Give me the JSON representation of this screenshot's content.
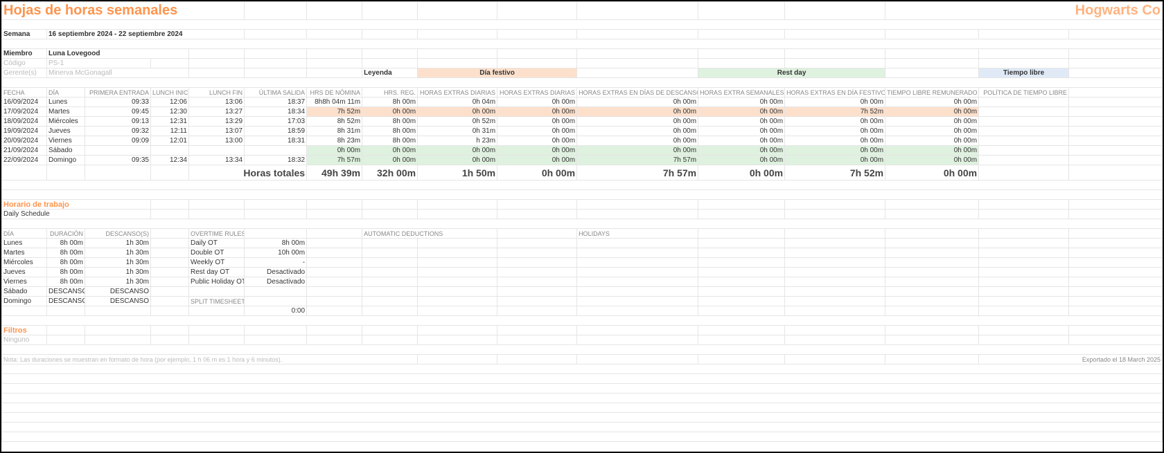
{
  "title": "Hojas de horas semanales",
  "company": "Hogwarts Co",
  "meta": {
    "week_label": "Semana",
    "week_value": "16 septiembre 2024 - 22 septiembre 2024",
    "member_label": "Miembro",
    "member_value": "Luna Lovegood",
    "code_label": "Código",
    "code_value": "PS-1",
    "managers_label": "Gerente(s)",
    "managers_value": "Minerva McGonagall"
  },
  "legend": {
    "label": "Leyenda",
    "holiday": "Día festivo",
    "rest": "Rest day",
    "timeoff": "Tiempo libre"
  },
  "columns": {
    "fecha": "FECHA",
    "dia": "DÍA",
    "primera": "PRIMERA ENTRADA",
    "lunch_in": "Lunch Inicio",
    "lunch_fin": "Lunch Fin",
    "ultima": "ÚLTIMA SALIDA",
    "nomina": "HRS DE NÓMINA",
    "reg": "HRS. REG.",
    "ot_diaria1": "HORAS EXTRAS DIARIAS",
    "ot_diaria2": "HORAS EXTRAS DIARIAS",
    "ot_descanso": "HORAS EXTRAS EN DÍAS DE DESCANSO",
    "ot_semanales": "HORAS EXTRA SEMANALES",
    "ot_festivo": "HORAS EXTRAS EN DÍA FESTIVO",
    "tiempo_rem": "TIEMPO LIBRE REMUNERADO",
    "politica": "POLÍTICA DE TIEMPO LIBRE"
  },
  "rows": [
    {
      "fecha": "16/09/2024",
      "dia": "Lunes",
      "in": "09:33",
      "li": "12:06",
      "lf": "13:06",
      "out": "18:37",
      "nom": "8h8h 04m 11m",
      "reg": "8h 00m",
      "d1": "0h 04m",
      "d2": "0h 00m",
      "desc": "0h 00m",
      "sem": "0h 00m",
      "fest": "0h 00m",
      "rem": "0h 00m",
      "cls": ""
    },
    {
      "fecha": "17/09/2024",
      "dia": "Martes",
      "in": "09:45",
      "li": "12:30",
      "lf": "13:27",
      "out": "18:34",
      "nom": "7h 52m",
      "reg": "0h 00m",
      "d1": "0h 00m",
      "d2": "0h 00m",
      "desc": "0h 00m",
      "sem": "0h 00m",
      "fest": "7h 52m",
      "rem": "0h 00m",
      "cls": "orange-fill"
    },
    {
      "fecha": "18/09/2024",
      "dia": "Miércoles",
      "in": "09:13",
      "li": "12:31",
      "lf": "13:29",
      "out": "17:03",
      "nom": "8h 52m",
      "reg": "8h 00m",
      "d1": "0h 52m",
      "d2": "0h 00m",
      "desc": "0h 00m",
      "sem": "0h 00m",
      "fest": "0h 00m",
      "rem": "0h 00m",
      "cls": ""
    },
    {
      "fecha": "19/09/2024",
      "dia": "Jueves",
      "in": "09:32",
      "li": "12:11",
      "lf": "13:07",
      "out": "18:59",
      "nom": "8h 31m",
      "reg": "8h 00m",
      "d1": "0h 31m",
      "d2": "0h 00m",
      "desc": "0h 00m",
      "sem": "0h 00m",
      "fest": "0h 00m",
      "rem": "0h 00m",
      "cls": ""
    },
    {
      "fecha": "20/09/2024",
      "dia": "Viernes",
      "in": "09:09",
      "li": "12:01",
      "lf": "13:00",
      "out": "18:31",
      "nom": "8h 23m",
      "reg": "8h 00m",
      "d1": "h 23m",
      "d2": "0h 00m",
      "desc": "0h 00m",
      "sem": "0h 00m",
      "fest": "0h 00m",
      "rem": "0h 00m",
      "cls": ""
    },
    {
      "fecha": "21/09/2024",
      "dia": "Sábado",
      "in": "",
      "li": "",
      "lf": "",
      "out": "",
      "nom": "0h 00m",
      "reg": "0h 00m",
      "d1": "0h 00m",
      "d2": "0h 00m",
      "desc": "0h 00m",
      "sem": "0h 00m",
      "fest": "0h 00m",
      "rem": "0h 00m",
      "cls": "green-fill"
    },
    {
      "fecha": "22/09/2024",
      "dia": "Domingo",
      "in": "09:35",
      "li": "12:34",
      "lf": "13:34",
      "out": "18:32",
      "nom": "7h 57m",
      "reg": "0h 00m",
      "d1": "0h 00m",
      "d2": "0h 00m",
      "desc": "7h 57m",
      "sem": "0h 00m",
      "fest": "0h 00m",
      "rem": "0h 00m",
      "cls": "green-fill"
    }
  ],
  "totals": {
    "label": "Horas totales",
    "nom": "49h 39m",
    "reg": "32h 00m",
    "d1": "1h 50m",
    "d2": "0h 00m",
    "desc": "7h 57m",
    "sem": "0h 00m",
    "fest": "7h 52m",
    "rem": "0h 00m"
  },
  "schedule": {
    "header": "Horario de trabajo",
    "name": "Daily Schedule",
    "dia": "DÍA",
    "dur": "DURACIÓN",
    "desc": "DESCANSO(S)",
    "rows": [
      {
        "d": "Lunes",
        "dur": "8h 00m",
        "desc": "1h 30m"
      },
      {
        "d": "Martes",
        "dur": "8h 00m",
        "desc": "1h 30m"
      },
      {
        "d": "Miércoles",
        "dur": "8h 00m",
        "desc": "1h 30m"
      },
      {
        "d": "Jueves",
        "dur": "8h 00m",
        "desc": "1h 30m"
      },
      {
        "d": "Viernes",
        "dur": "8h 00m",
        "desc": "1h 30m"
      },
      {
        "d": "Sábado",
        "dur": "DESCANSO",
        "desc": "DESCANSO"
      },
      {
        "d": "Domingo",
        "dur": "DESCANSO",
        "desc": "DESCANSO"
      }
    ]
  },
  "overtime": {
    "header": "OVERTIME RULES",
    "rows": [
      {
        "k": "Daily OT",
        "v": "8h 00m"
      },
      {
        "k": "Double OT",
        "v": "10h 00m"
      },
      {
        "k": "Weekly OT",
        "v": "-"
      },
      {
        "k": "Rest day OT",
        "v": "Desactivado"
      },
      {
        "k": "Public Holiday OT",
        "v": "Desactivado"
      }
    ],
    "split_header": "SPLIT TIMESHEET",
    "split_val": "0:00"
  },
  "deductions_header": "AUTOMATIC DEDUCTIONS",
  "holidays_header": "HOLIDAYS",
  "filters": {
    "header": "Filtros",
    "value": "Ninguno"
  },
  "note": "Nota: Las duraciones se muestran en formato de hora (por ejemplo, 1 h 06 m es 1 hora y 6 minutos).",
  "export": "Exportado el 18 March 2025"
}
